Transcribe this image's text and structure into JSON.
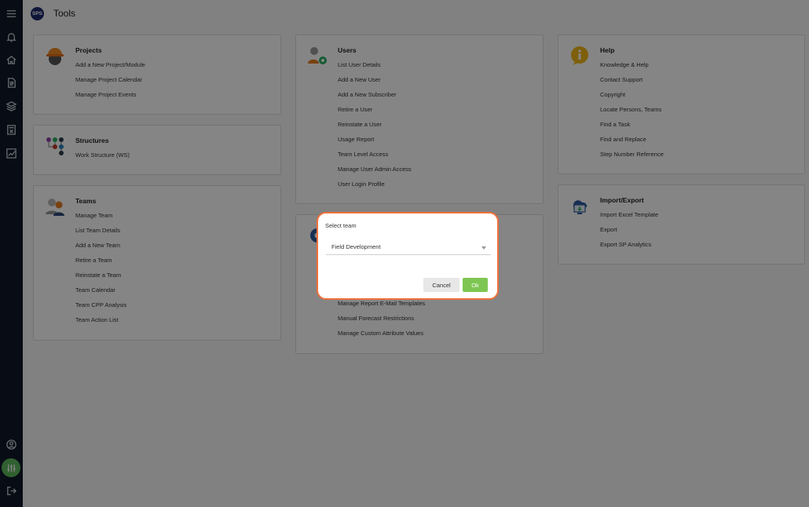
{
  "app": {
    "logo_text": "SPS",
    "title": "Tools"
  },
  "rail": {
    "items": [
      "menu-icon",
      "bell-icon",
      "home-icon",
      "document-icon",
      "layers-icon",
      "calculator-icon",
      "chart-icon"
    ],
    "bottom": [
      "user-icon",
      "sliders-icon",
      "logout-icon"
    ],
    "active_color": "#5cb85c",
    "bg": "#10182a"
  },
  "cards": {
    "projects": {
      "title": "Projects",
      "items": [
        "Add a New Project/Module",
        "Manage Project Calendar",
        "Manage Project Events"
      ]
    },
    "structures": {
      "title": "Structures",
      "items": [
        "Work Structure (WS)"
      ]
    },
    "teams": {
      "title": "Teams",
      "items": [
        "Manage Team",
        "List Team Details",
        "Add a New Team",
        "Retire a Team",
        "Reinstate a Team",
        "Team Calendar",
        "Team CPP Analysis",
        "Team Action List"
      ]
    },
    "users": {
      "title": "Users",
      "items": [
        "List User Details",
        "Add a New User",
        "Add a New Subscriber",
        "Retire a User",
        "Reinstate a User",
        "Usage Report",
        "Team Level Access",
        "Manage User Admin Access",
        "User Login Profile"
      ]
    },
    "admin": {
      "items": [
        "Manage Report E-Mail Templates",
        "Manual Forecast Restrictions",
        "Manage Custom Attribute Values"
      ]
    },
    "help": {
      "title": "Help",
      "items": [
        "Knowledge & Help",
        "Contact Support",
        "Copyright",
        "Locate Persons, Teams",
        "Find a Task",
        "Find and Replace",
        "Step Number Reference"
      ]
    },
    "import_export": {
      "title": "Import/Export",
      "items": [
        "Import Excel Template",
        "Export",
        "Export SP Analytics"
      ]
    }
  },
  "dialog": {
    "title": "Select team",
    "selected": "Field Development",
    "cancel_label": "Cancel",
    "ok_label": "Ok",
    "border_color": "#f0703a",
    "ok_color": "#7dc652"
  }
}
